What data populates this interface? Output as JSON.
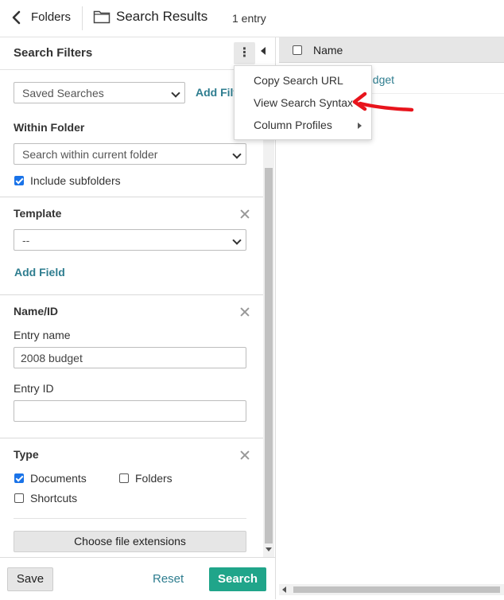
{
  "topbar": {
    "back_label": "Folders",
    "title": "Search Results",
    "entry_count": "1 entry",
    "back_icon": "chevron-left-icon",
    "folder_icon": "folder-icon"
  },
  "search_filters": {
    "title": "Search Filters",
    "menu_icon": "kebab-icon",
    "saved_searches": {
      "value": "Saved Searches"
    },
    "add_filter_label": "Add Filt",
    "within_folder": {
      "heading": "Within Folder",
      "select_value": "Search within current folder",
      "include_subfolders_label": "Include subfolders",
      "include_subfolders_checked": true
    },
    "template": {
      "heading": "Template",
      "select_value": "--",
      "add_field_label": "Add Field"
    },
    "name_id": {
      "heading": "Name/ID",
      "entry_name_label": "Entry name",
      "entry_name_value": "2008 budget",
      "entry_id_label": "Entry ID",
      "entry_id_value": ""
    },
    "type": {
      "heading": "Type",
      "options": [
        {
          "label": "Documents",
          "checked": true
        },
        {
          "label": "Folders",
          "checked": false
        },
        {
          "label": "Shortcuts",
          "checked": false
        }
      ],
      "choose_ext_label": "Choose file extensions"
    },
    "footer": {
      "save_label": "Save",
      "reset_label": "Reset",
      "search_label": "Search"
    }
  },
  "results": {
    "column_name": "Name",
    "rows": [
      {
        "name_visible": "udget"
      }
    ]
  },
  "context_menu": {
    "items": [
      {
        "label": "Copy Search URL"
      },
      {
        "label": "View Search Syntax"
      },
      {
        "label": "Column Profiles",
        "has_submenu": true
      }
    ]
  },
  "colors": {
    "accent": "#2e7d8f",
    "primary_button": "#20a58a",
    "checkbox": "#1a73e8",
    "annotation_arrow": "#e8141c"
  }
}
